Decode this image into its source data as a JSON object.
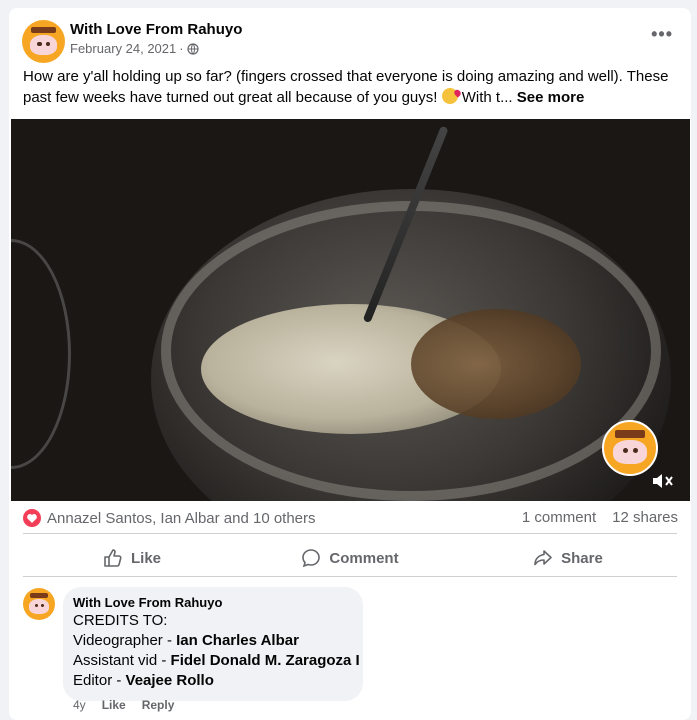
{
  "post": {
    "page_name": "With Love From Rahuyo",
    "date": "February 24, 2021",
    "date_separator": "·",
    "more_label": "•••",
    "text": "How are y'all holding up so far? (fingers crossed that everyone is doing amazing and well). These past few weeks have turned out great all because of you guys!",
    "text_tail": "With t...",
    "see_more": "See more"
  },
  "reactions": {
    "summary": "Annazel Santos, Ian Albar and 10 others",
    "comments": "1 comment",
    "shares": "12 shares"
  },
  "actions": {
    "like": "Like",
    "comment": "Comment",
    "share": "Share"
  },
  "comment": {
    "author": "With Love From Rahuyo",
    "lines": [
      {
        "prefix": "CREDITS TO:",
        "name": ""
      },
      {
        "prefix": "Videographer - ",
        "name": "Ian Charles Albar"
      },
      {
        "prefix": "Assistant vid - ",
        "name": "Fidel Donald M. Zaragoza I"
      },
      {
        "prefix": "Editor - ",
        "name": "Veajee Rollo"
      }
    ],
    "age": "4y",
    "like": "Like",
    "reply": "Reply"
  },
  "colors": {
    "brand_orange": "#f6a623",
    "love_red": "#f33e58",
    "muted_text": "#65676b"
  },
  "icons": [
    "globe-icon",
    "more-icon",
    "love-reaction-icon",
    "like-icon",
    "comment-icon",
    "share-icon",
    "mute-icon",
    "smiling-face-with-hearts-emoji"
  ]
}
